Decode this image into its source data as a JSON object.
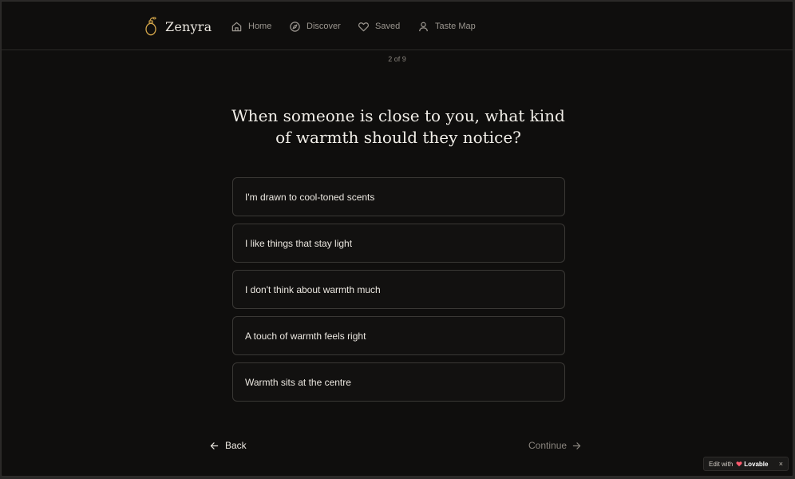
{
  "brand": {
    "name": "Zenyra",
    "accent": "#d4a64a"
  },
  "nav": [
    {
      "label": "Home",
      "icon": "home-icon"
    },
    {
      "label": "Discover",
      "icon": "compass-icon"
    },
    {
      "label": "Saved",
      "icon": "heart-icon"
    },
    {
      "label": "Taste Map",
      "icon": "user-icon"
    }
  ],
  "quiz": {
    "progress": "2 of 9",
    "question": "When someone is close to you, what kind of warmth should they notice?",
    "options": [
      "I'm drawn to cool-toned scents",
      "I like things that stay light",
      "I don't think about warmth much",
      "A touch of warmth feels right",
      "Warmth sits at the centre"
    ],
    "back_label": "Back",
    "continue_label": "Continue"
  },
  "badge": {
    "prefix": "Edit with",
    "brand": "Lovable",
    "close": "×",
    "heart_color": "#ff5a6e"
  }
}
